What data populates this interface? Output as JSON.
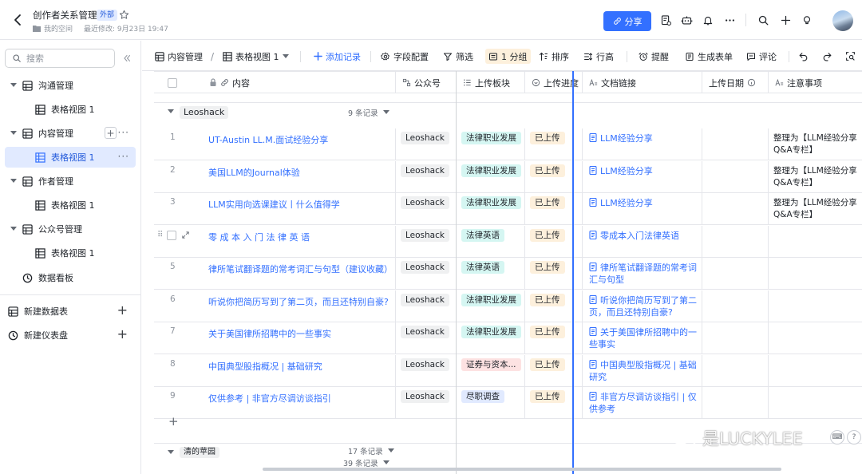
{
  "header": {
    "title": "创作者关系管理",
    "badge": "外部",
    "space": "我的空间",
    "modified": "最近修改: 9月23日 19:47",
    "share_label": "分享"
  },
  "sidebar": {
    "search_placeholder": "搜索",
    "items": [
      {
        "label": "沟通管理",
        "type": "table"
      },
      {
        "label": "表格视图 1",
        "type": "view"
      },
      {
        "label": "内容管理",
        "type": "table"
      },
      {
        "label": "表格视图 1",
        "type": "view",
        "active": true
      },
      {
        "label": "作者管理",
        "type": "table"
      },
      {
        "label": "表格视图 1",
        "type": "view"
      },
      {
        "label": "公众号管理",
        "type": "table"
      },
      {
        "label": "表格视图 1",
        "type": "view"
      },
      {
        "label": "数据看板",
        "type": "dashboard"
      }
    ],
    "new_table": "新建数据表",
    "new_dashboard": "新建仪表盘"
  },
  "toolbar": {
    "breadcrumb_table": "内容管理",
    "breadcrumb_view": "表格视图 1",
    "add_record": "添加记录",
    "field_config": "字段配置",
    "filter": "筛选",
    "group": "1 分组",
    "sort": "排序",
    "row_height": "行高",
    "remind": "提醒",
    "generate_form": "生成表单",
    "comment": "评论"
  },
  "columns": [
    "内容",
    "公众号",
    "上传板块",
    "上传进度",
    "文档链接",
    "上传日期",
    "注意事项"
  ],
  "group1": {
    "name": "Leoshack",
    "count": "9 条记录"
  },
  "rows": [
    {
      "num": "1",
      "title": "UT-Austin LL.M.面试经验分享",
      "account": "Leoshack",
      "section": "法律职业发展",
      "section_color": "#d5f6f2",
      "status": "已上传",
      "link": "LLM经验分享",
      "note": "整理为【LLM经验分享 Q&A专栏】"
    },
    {
      "num": "2",
      "title": "美国LLM的Journal体验",
      "account": "Leoshack",
      "section": "法律职业发展",
      "section_color": "#d5f6f2",
      "status": "已上传",
      "link": "LLM经验分享",
      "note": "整理为【LLM经验分享 Q&A专栏】"
    },
    {
      "num": "3",
      "title": "LLM实用向选课建议丨什么值得学",
      "account": "Leoshack",
      "section": "法律职业发展",
      "section_color": "#d5f6f2",
      "status": "已上传",
      "link": "LLM经验分享",
      "note": "整理为【LLM经验分享 Q&A专栏】"
    },
    {
      "num": "",
      "title": "零 成 本 入 门 法 律 英 语",
      "account": "Leoshack",
      "section": "法律英语",
      "section_color": "#d5f6f2",
      "status": "已上传",
      "link": "零成本入门法律英语",
      "note": ""
    },
    {
      "num": "5",
      "title": "律所笔试翻译题的常考词汇与句型（建议收藏）",
      "account": "Leoshack",
      "section": "法律英语",
      "section_color": "#d5f6f2",
      "status": "已上传",
      "link": "律所笔试翻译题的常考词汇与句型",
      "note": ""
    },
    {
      "num": "6",
      "title": "听说你把简历写到了第二页，而且还特别自豪?",
      "account": "Leoshack",
      "section": "法律职业发展",
      "section_color": "#d5f6f2",
      "status": "已上传",
      "link": "听说你把简历写到了第二页，而且还特别自豪?",
      "note": ""
    },
    {
      "num": "7",
      "title": "关于美国律所招聘中的一些事实",
      "account": "Leoshack",
      "section": "法律职业发展",
      "section_color": "#d5f6f2",
      "status": "已上传",
      "link": "关于美国律所招聘中的一些事实",
      "note": ""
    },
    {
      "num": "8",
      "title": "中国典型股指概况 | 基础研究",
      "account": "Leoshack",
      "section": "证券与资本...",
      "section_color": "#fde2e2",
      "status": "已上传",
      "link": "中国典型股指概况 | 基础研究",
      "note": ""
    },
    {
      "num": "9",
      "title": "仅供参考 | 非官方尽调访谈指引",
      "account": "Leoshack",
      "section": "尽职调查",
      "section_color": "#e1eaff",
      "status": "已上传",
      "link": "非官方尽调访谈指引 | 仅供参考",
      "note": ""
    }
  ],
  "group2": {
    "name": "清的苹园",
    "count": "17 条记录"
  },
  "footer_count": "39 条记录",
  "watermark": "是LUCKYLEE"
}
